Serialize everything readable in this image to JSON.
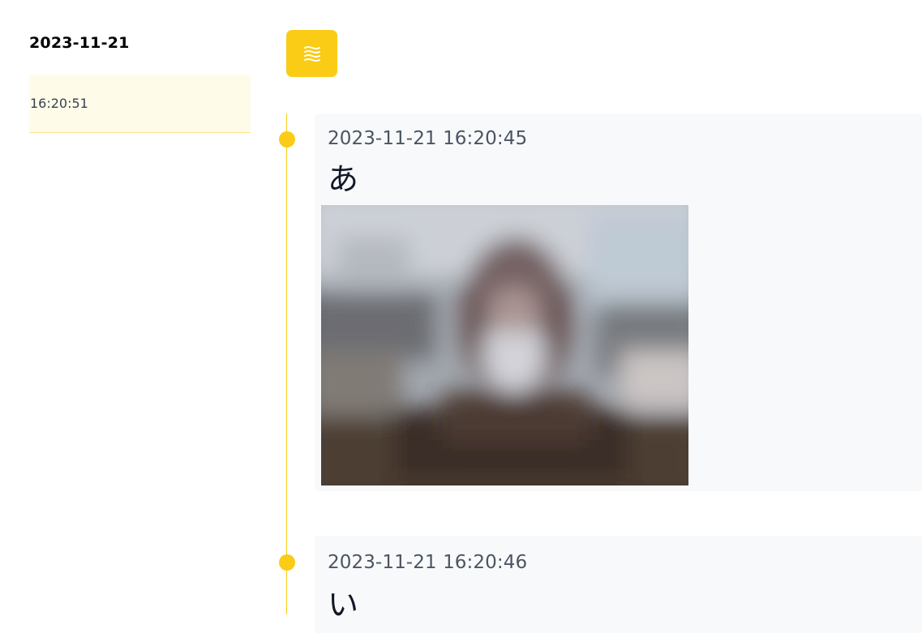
{
  "sidebar": {
    "date": "2023-11-21",
    "items": [
      {
        "time": "16:20:51"
      }
    ]
  },
  "toolbar": {
    "menu_icon": "menu-lines-icon",
    "accent_color": "#facc15"
  },
  "timeline": {
    "entries": [
      {
        "timestamp": "2023-11-21 16:20:45",
        "text": "あ",
        "has_photo": true
      },
      {
        "timestamp": "2023-11-21 16:20:46",
        "text": "い",
        "has_photo": false
      }
    ]
  }
}
